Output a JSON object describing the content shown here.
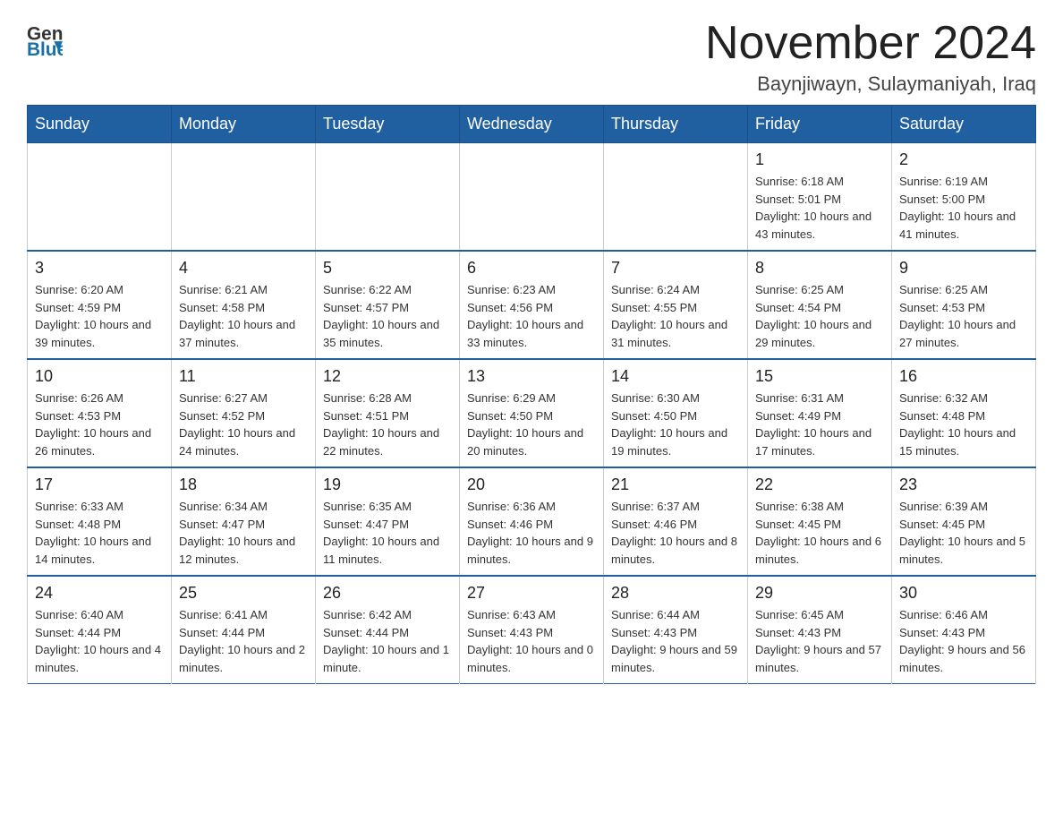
{
  "header": {
    "logo_general": "General",
    "logo_blue": "Blue",
    "title": "November 2024",
    "subtitle": "Baynjiwayn, Sulaymaniyah, Iraq"
  },
  "calendar": {
    "days_of_week": [
      "Sunday",
      "Monday",
      "Tuesday",
      "Wednesday",
      "Thursday",
      "Friday",
      "Saturday"
    ],
    "weeks": [
      [
        {
          "day": "",
          "info": ""
        },
        {
          "day": "",
          "info": ""
        },
        {
          "day": "",
          "info": ""
        },
        {
          "day": "",
          "info": ""
        },
        {
          "day": "",
          "info": ""
        },
        {
          "day": "1",
          "info": "Sunrise: 6:18 AM\nSunset: 5:01 PM\nDaylight: 10 hours and 43 minutes."
        },
        {
          "day": "2",
          "info": "Sunrise: 6:19 AM\nSunset: 5:00 PM\nDaylight: 10 hours and 41 minutes."
        }
      ],
      [
        {
          "day": "3",
          "info": "Sunrise: 6:20 AM\nSunset: 4:59 PM\nDaylight: 10 hours and 39 minutes."
        },
        {
          "day": "4",
          "info": "Sunrise: 6:21 AM\nSunset: 4:58 PM\nDaylight: 10 hours and 37 minutes."
        },
        {
          "day": "5",
          "info": "Sunrise: 6:22 AM\nSunset: 4:57 PM\nDaylight: 10 hours and 35 minutes."
        },
        {
          "day": "6",
          "info": "Sunrise: 6:23 AM\nSunset: 4:56 PM\nDaylight: 10 hours and 33 minutes."
        },
        {
          "day": "7",
          "info": "Sunrise: 6:24 AM\nSunset: 4:55 PM\nDaylight: 10 hours and 31 minutes."
        },
        {
          "day": "8",
          "info": "Sunrise: 6:25 AM\nSunset: 4:54 PM\nDaylight: 10 hours and 29 minutes."
        },
        {
          "day": "9",
          "info": "Sunrise: 6:25 AM\nSunset: 4:53 PM\nDaylight: 10 hours and 27 minutes."
        }
      ],
      [
        {
          "day": "10",
          "info": "Sunrise: 6:26 AM\nSunset: 4:53 PM\nDaylight: 10 hours and 26 minutes."
        },
        {
          "day": "11",
          "info": "Sunrise: 6:27 AM\nSunset: 4:52 PM\nDaylight: 10 hours and 24 minutes."
        },
        {
          "day": "12",
          "info": "Sunrise: 6:28 AM\nSunset: 4:51 PM\nDaylight: 10 hours and 22 minutes."
        },
        {
          "day": "13",
          "info": "Sunrise: 6:29 AM\nSunset: 4:50 PM\nDaylight: 10 hours and 20 minutes."
        },
        {
          "day": "14",
          "info": "Sunrise: 6:30 AM\nSunset: 4:50 PM\nDaylight: 10 hours and 19 minutes."
        },
        {
          "day": "15",
          "info": "Sunrise: 6:31 AM\nSunset: 4:49 PM\nDaylight: 10 hours and 17 minutes."
        },
        {
          "day": "16",
          "info": "Sunrise: 6:32 AM\nSunset: 4:48 PM\nDaylight: 10 hours and 15 minutes."
        }
      ],
      [
        {
          "day": "17",
          "info": "Sunrise: 6:33 AM\nSunset: 4:48 PM\nDaylight: 10 hours and 14 minutes."
        },
        {
          "day": "18",
          "info": "Sunrise: 6:34 AM\nSunset: 4:47 PM\nDaylight: 10 hours and 12 minutes."
        },
        {
          "day": "19",
          "info": "Sunrise: 6:35 AM\nSunset: 4:47 PM\nDaylight: 10 hours and 11 minutes."
        },
        {
          "day": "20",
          "info": "Sunrise: 6:36 AM\nSunset: 4:46 PM\nDaylight: 10 hours and 9 minutes."
        },
        {
          "day": "21",
          "info": "Sunrise: 6:37 AM\nSunset: 4:46 PM\nDaylight: 10 hours and 8 minutes."
        },
        {
          "day": "22",
          "info": "Sunrise: 6:38 AM\nSunset: 4:45 PM\nDaylight: 10 hours and 6 minutes."
        },
        {
          "day": "23",
          "info": "Sunrise: 6:39 AM\nSunset: 4:45 PM\nDaylight: 10 hours and 5 minutes."
        }
      ],
      [
        {
          "day": "24",
          "info": "Sunrise: 6:40 AM\nSunset: 4:44 PM\nDaylight: 10 hours and 4 minutes."
        },
        {
          "day": "25",
          "info": "Sunrise: 6:41 AM\nSunset: 4:44 PM\nDaylight: 10 hours and 2 minutes."
        },
        {
          "day": "26",
          "info": "Sunrise: 6:42 AM\nSunset: 4:44 PM\nDaylight: 10 hours and 1 minute."
        },
        {
          "day": "27",
          "info": "Sunrise: 6:43 AM\nSunset: 4:43 PM\nDaylight: 10 hours and 0 minutes."
        },
        {
          "day": "28",
          "info": "Sunrise: 6:44 AM\nSunset: 4:43 PM\nDaylight: 9 hours and 59 minutes."
        },
        {
          "day": "29",
          "info": "Sunrise: 6:45 AM\nSunset: 4:43 PM\nDaylight: 9 hours and 57 minutes."
        },
        {
          "day": "30",
          "info": "Sunrise: 6:46 AM\nSunset: 4:43 PM\nDaylight: 9 hours and 56 minutes."
        }
      ]
    ]
  }
}
